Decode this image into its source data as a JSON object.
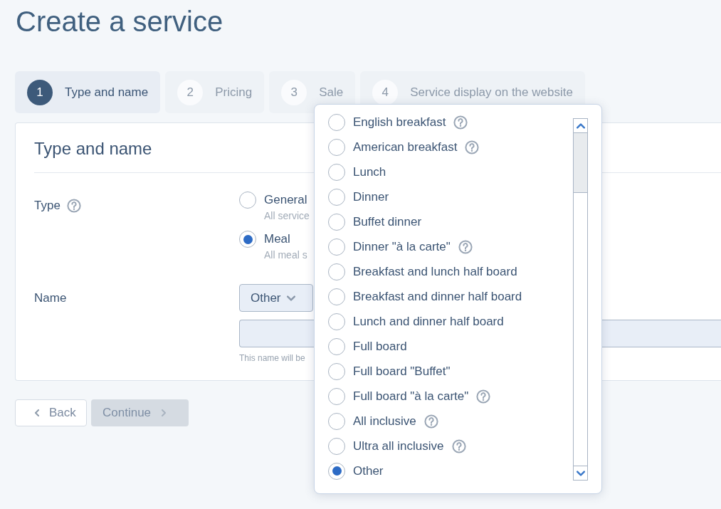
{
  "page": {
    "title": "Create a service"
  },
  "steps": [
    {
      "number": "1",
      "label": "Type and name",
      "selected": true,
      "disabled": false
    },
    {
      "number": "2",
      "label": "Pricing",
      "selected": false,
      "disabled": true
    },
    {
      "number": "3",
      "label": "Sale",
      "selected": false,
      "disabled": true
    },
    {
      "number": "4",
      "label": "Service display on the website",
      "selected": false,
      "disabled": true
    }
  ],
  "form": {
    "heading": "Type and name",
    "type": {
      "label": "Type",
      "help": true,
      "options": [
        {
          "label": "General",
          "description": "All service",
          "selected": false
        },
        {
          "label": "Meal",
          "description": "All meal s",
          "selected": true
        }
      ]
    },
    "name": {
      "label": "Name",
      "select": {
        "value": "Other"
      },
      "input": {
        "helper_text": "This name will be"
      }
    }
  },
  "buttons": [
    {
      "kind": "back",
      "label": "Back",
      "disabled": false
    },
    {
      "kind": "continue",
      "label": "Continue",
      "disabled": true
    }
  ],
  "menu": {
    "options": [
      {
        "label": "English breakfast",
        "help": true,
        "selected": false
      },
      {
        "label": "American breakfast",
        "help": true,
        "selected": false
      },
      {
        "label": "Lunch",
        "help": false,
        "selected": false
      },
      {
        "label": "Dinner",
        "help": false,
        "selected": false
      },
      {
        "label": "Buffet dinner",
        "help": false,
        "selected": false
      },
      {
        "label": "Dinner \"à la carte\"",
        "help": true,
        "selected": false
      },
      {
        "label": "Breakfast and lunch half board",
        "help": false,
        "selected": false
      },
      {
        "label": "Breakfast and dinner half board",
        "help": false,
        "selected": false
      },
      {
        "label": "Lunch and dinner half board",
        "help": false,
        "selected": false
      },
      {
        "label": "Full board",
        "help": false,
        "selected": false
      },
      {
        "label": "Full board \"Buffet\"",
        "help": false,
        "selected": false
      },
      {
        "label": "Full board \"à la carte\"",
        "help": true,
        "selected": false
      },
      {
        "label": "All inclusive",
        "help": true,
        "selected": false
      },
      {
        "label": "Ultra all inclusive",
        "help": true,
        "selected": false
      },
      {
        "label": "Other",
        "help": false,
        "selected": true
      }
    ]
  }
}
